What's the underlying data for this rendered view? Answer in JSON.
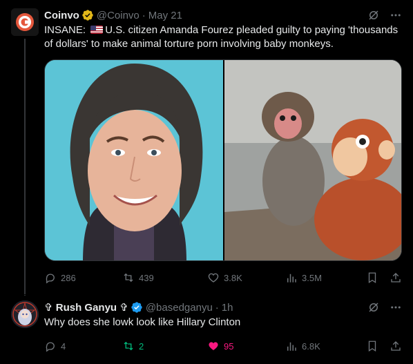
{
  "post1": {
    "author_name": "Coinvo",
    "handle": "@Coinvo",
    "date": "May 21",
    "text_before_flag": "INSANE:",
    "text_after_flag": "U.S. citizen Amanda Fourez pleaded guilty to paying 'thousands of dollars' to make animal torture porn involving baby monkeys.",
    "media": [
      "mugshot photo",
      "monkey with plush toy photo"
    ],
    "stats": {
      "replies": "286",
      "reposts": "439",
      "likes": "3.8K",
      "views": "3.5M"
    }
  },
  "post2": {
    "author_name": "✞ Rush Ganyu ✞",
    "handle": "@basedganyu",
    "time": "1h",
    "text": "Why does she lowk look like Hillary Clinton",
    "stats": {
      "replies": "4",
      "reposts": "2",
      "likes": "95",
      "views": "6.8K"
    }
  },
  "colors": {
    "background": "#000000",
    "text": "#e7e9ea",
    "muted": "#71767b",
    "verified_gold": "#e2b719",
    "verified_blue": "#1d9bf0",
    "repost_green": "#00ba7c",
    "like_pink": "#f91880"
  }
}
